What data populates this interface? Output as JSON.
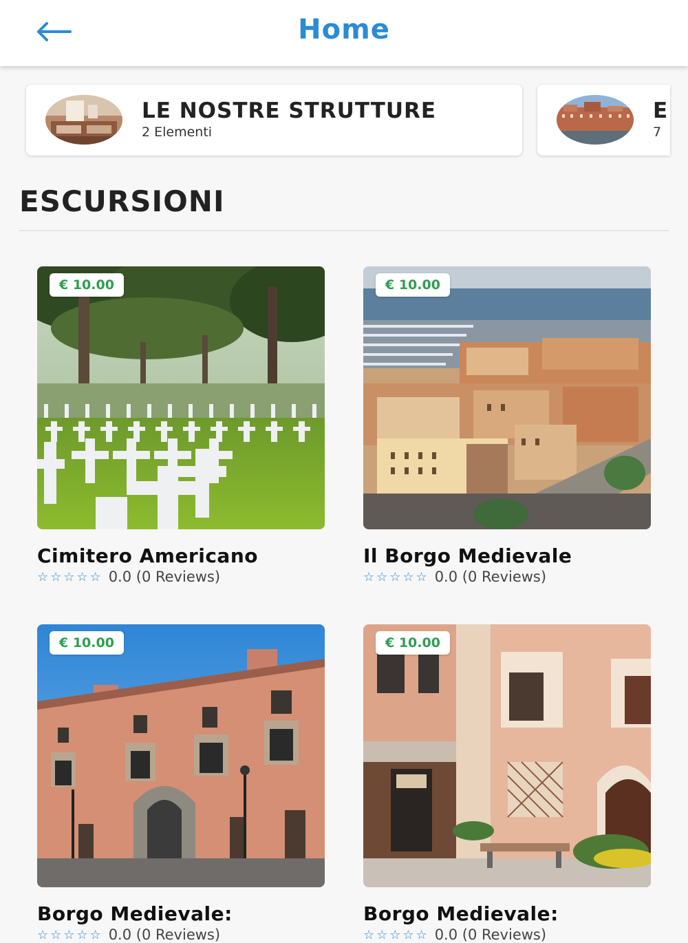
{
  "header": {
    "title": "Home",
    "back_icon": "arrow-left-icon",
    "accent_color": "#2a8bd6"
  },
  "categories": [
    {
      "title": "LE NOSTRE STRUTTURE",
      "count": "2 Elementi"
    },
    {
      "title": "E",
      "count": "7"
    }
  ],
  "section": {
    "title": "ESCURSIONI"
  },
  "tours": [
    {
      "name": "Cimitero Americano",
      "price": "€ 10.00",
      "stars": "☆☆☆☆☆",
      "rating": "0.0 (0 Reviews)"
    },
    {
      "name": "Il Borgo Medievale",
      "price": "€ 10.00",
      "stars": "☆☆☆☆☆",
      "rating": "0.0 (0 Reviews)"
    },
    {
      "name": "Borgo Medievale:",
      "price": "€ 10.00",
      "stars": "☆☆☆☆☆",
      "rating": "0.0 (0 Reviews)"
    },
    {
      "name": "Borgo Medievale:",
      "price": "€ 10.00",
      "stars": "☆☆☆☆☆",
      "rating": "0.0 (0 Reviews)"
    }
  ]
}
